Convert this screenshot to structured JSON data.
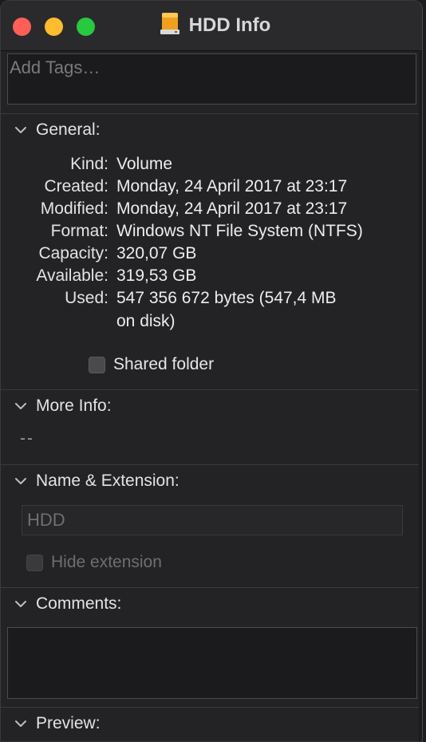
{
  "window": {
    "title": "HDD Info",
    "icon": "hdd-icon"
  },
  "tags": {
    "placeholder": "Add Tags…"
  },
  "general": {
    "title": "General:",
    "rows": [
      {
        "label": "Kind:",
        "value": "Volume"
      },
      {
        "label": "Created:",
        "value": "Monday, 24 April 2017 at 23:17"
      },
      {
        "label": "Modified:",
        "value": "Monday, 24 April 2017 at 23:17"
      },
      {
        "label": "Format:",
        "value": "Windows NT File System (NTFS)"
      },
      {
        "label": "Capacity:",
        "value": "320,07 GB"
      },
      {
        "label": "Available:",
        "value": "319,53 GB"
      },
      {
        "label": "Used:",
        "value": "547 356 672 bytes (547,4 MB",
        "value_line2": "on disk)"
      }
    ],
    "shared_folder_label": "Shared folder",
    "shared_folder_checked": false
  },
  "more_info": {
    "title": "More Info:",
    "value": "--"
  },
  "name_extension": {
    "title": "Name & Extension:",
    "name_value": "HDD",
    "hide_extension_label": "Hide extension",
    "hide_extension_checked": false
  },
  "comments": {
    "title": "Comments:",
    "value": ""
  },
  "preview": {
    "title": "Preview:"
  }
}
